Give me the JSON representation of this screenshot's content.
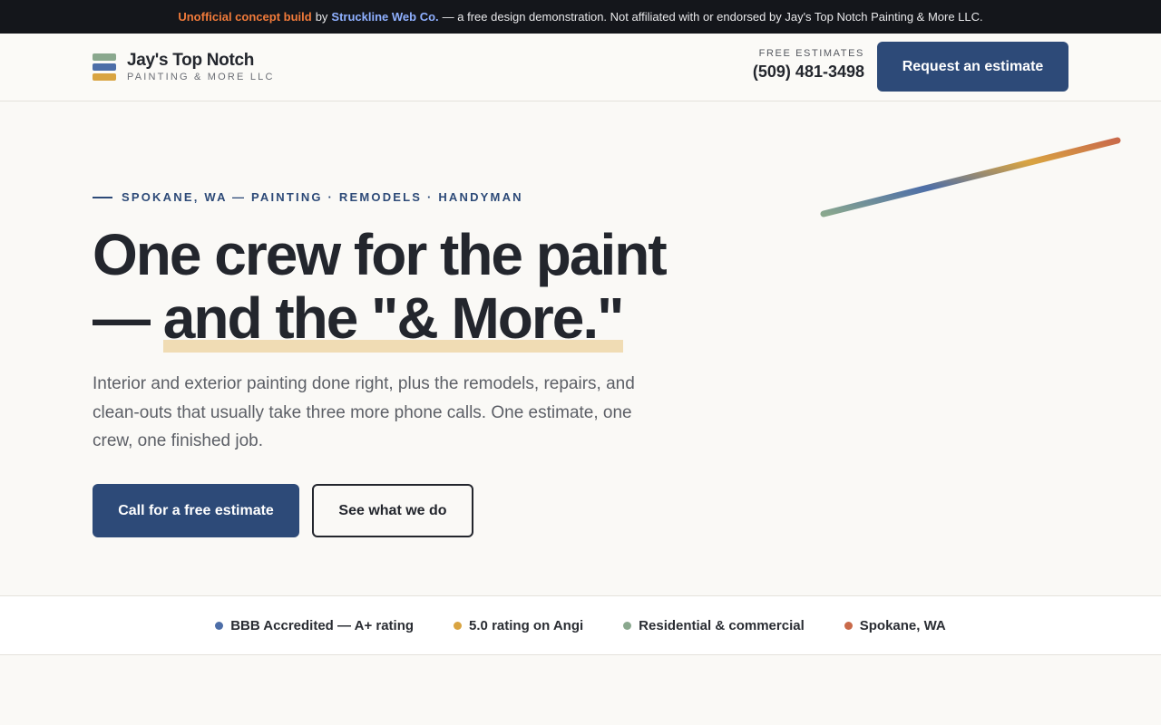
{
  "banner": {
    "part1": "Unofficial concept build",
    "part2": "by",
    "part3": "Struckline Web Co.",
    "part4": "— a free design demonstration. Not affiliated with or endorsed by Jay's Top Notch Painting & More LLC."
  },
  "header": {
    "brand_name": "Jay's Top Notch",
    "brand_sub": "PAINTING & MORE LLC",
    "logo_colors": [
      "#8aa88e",
      "#4d6ea8",
      "#d9a441"
    ],
    "estimate_label": "FREE ESTIMATES",
    "phone": "(509) 481-3498",
    "cta_label": "Request an estimate"
  },
  "hero": {
    "eyebrow": "SPOKANE, WA — PAINTING · REMODELS · HANDYMAN",
    "headline_line1": "One crew for the paint",
    "headline_dash": "—",
    "headline_highlight": "and the \"& More.\"",
    "lede": "Interior and exterior painting done right, plus the remodels, repairs, and clean-outs that usually take three more phone calls. One estimate, one crew, one finished job.",
    "primary_cta": "Call for a free estimate",
    "secondary_cta": "See what we do"
  },
  "trust": {
    "items": [
      {
        "label": "BBB Accredited — A+ rating",
        "color": "#4d6ea8"
      },
      {
        "label": "5.0 rating on Angi",
        "color": "#d9a441"
      },
      {
        "label": "Residential & commercial",
        "color": "#8aa88e"
      },
      {
        "label": "Spokane, WA",
        "color": "#c96a4a"
      }
    ]
  },
  "colors": {
    "brand_navy": "#2d4a78",
    "highlight": "#f0dcb4",
    "stroke_gradient": [
      "#8aa88e",
      "#4d6ea8",
      "#d9a441",
      "#c96a4a"
    ]
  }
}
